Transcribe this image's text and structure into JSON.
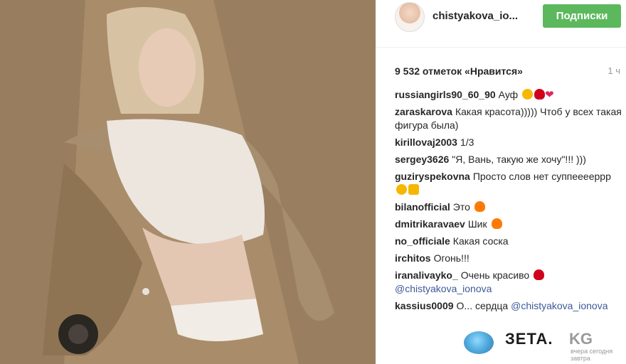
{
  "header": {
    "username": "chistyakova_io...",
    "follow_label": "Подписки"
  },
  "post": {
    "likes": "9 532 отметок «Нравится»",
    "time": "1 ч"
  },
  "comments": [
    {
      "user": "russiangirls90_60_90",
      "text": "Ауф"
    },
    {
      "user": "zaraskarova",
      "text": "Какая красота))))) Чтоб у всех такая фигура была)"
    },
    {
      "user": "kirillovaj2003",
      "text": "1/3"
    },
    {
      "user": "sergey3626",
      "text": "\"Я, Вань, такую же хочу\"!!! )))"
    },
    {
      "user": "guziryspekovna",
      "text": "Просто слов нет суппееееррр"
    },
    {
      "user": "bilanofficial",
      "text": "Это"
    },
    {
      "user": "dmitrikaravaev",
      "text": "Шик"
    },
    {
      "user": "no_officiale",
      "text": "Какая соска"
    },
    {
      "user": "irchitos",
      "text": "Огонь!!!"
    },
    {
      "user": "iranalivayko_",
      "text": "Очень красиво",
      "mention": "@chistyakova_ionova"
    },
    {
      "user": "kassius0009",
      "text": "О... сердца",
      "mention": "@chistyakova_ionova"
    }
  ],
  "watermark": {
    "brand": "ЗЕТА.",
    "kg": "KG",
    "tagline": "вчера сегодня завтра"
  }
}
